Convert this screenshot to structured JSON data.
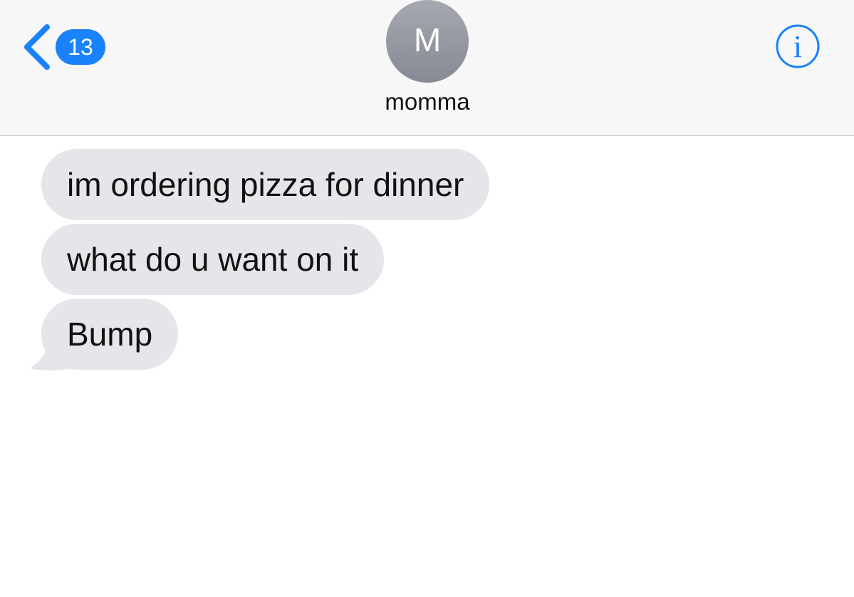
{
  "header": {
    "back_badge": "13",
    "contact_initial": "M",
    "contact_name": "momma"
  },
  "messages": [
    {
      "text": "im ordering pizza for dinner",
      "direction": "incoming"
    },
    {
      "text": "what do u want on it",
      "direction": "incoming"
    },
    {
      "text": "Bump",
      "direction": "incoming"
    }
  ],
  "colors": {
    "accent": "#1a82fb",
    "incoming_bubble": "#e5e5ea",
    "header_bg": "#f7f7f7"
  },
  "icons": {
    "back": "chevron-left-icon",
    "info": "info-icon"
  }
}
